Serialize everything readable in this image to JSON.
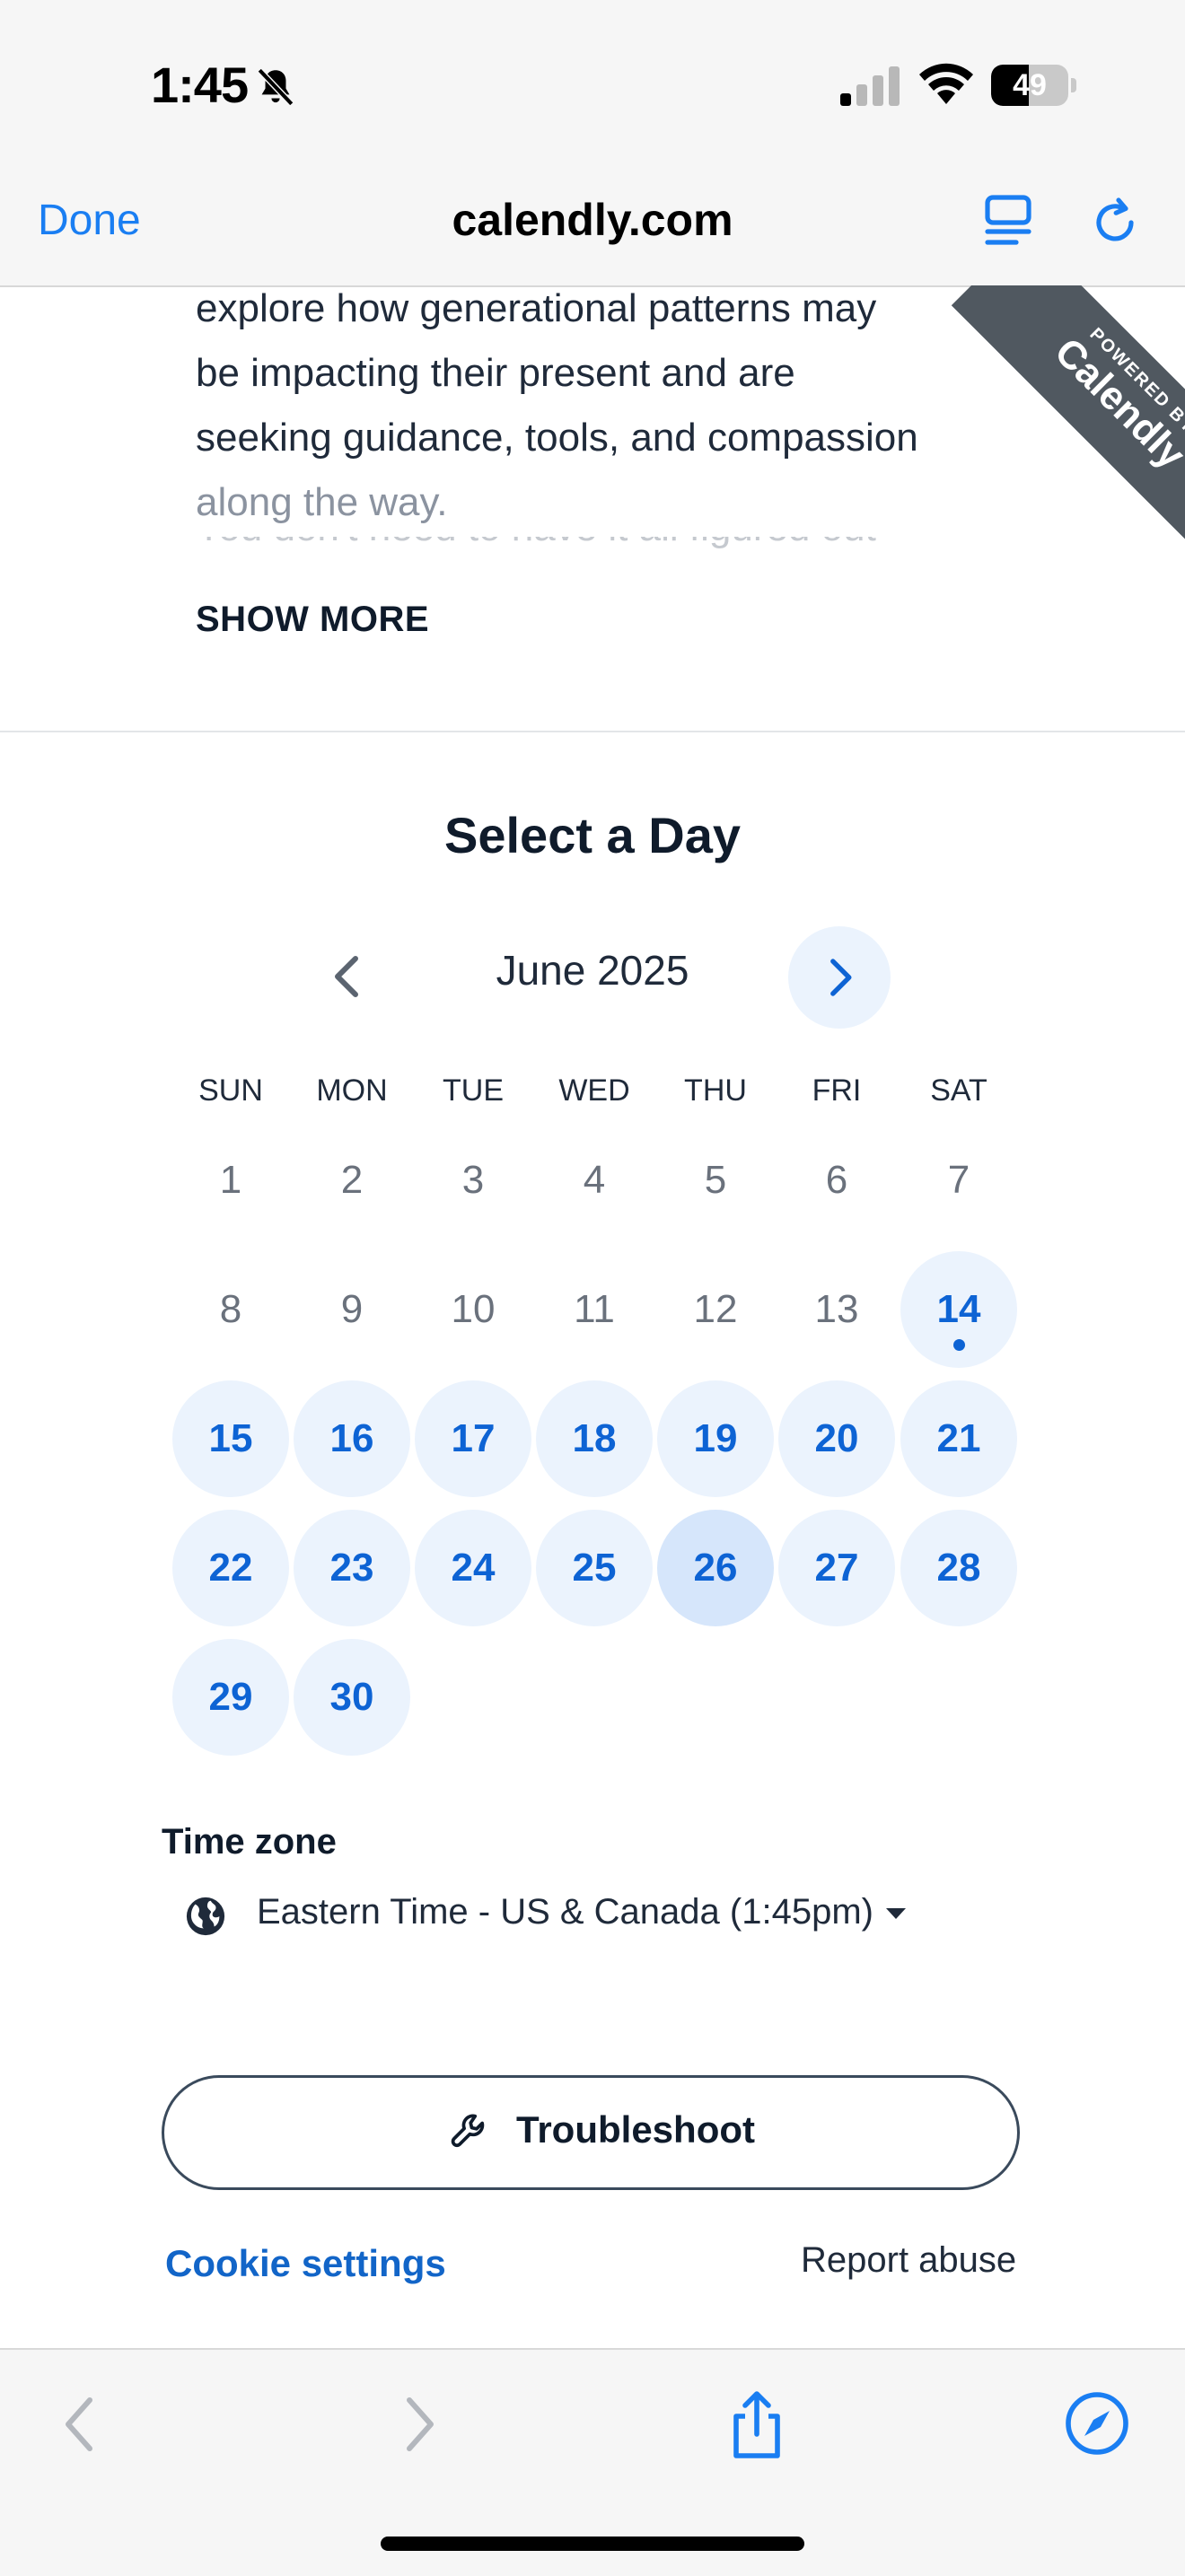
{
  "status_bar": {
    "time": "1:45",
    "battery_level": "49",
    "icons": [
      "bell-slash-icon",
      "cellular-signal-icon",
      "wifi-icon",
      "battery-icon"
    ]
  },
  "browser": {
    "done_label": "Done",
    "domain": "calendly.com",
    "icons": [
      "reader-icon",
      "reload-icon"
    ]
  },
  "description": {
    "lines": [
      "explore how generational patterns may",
      "be impacting their present and are",
      "seeking guidance, tools, and compassion",
      "along the way."
    ],
    "cut_line": "You don't need to have it all figured out",
    "show_more": "SHOW MORE"
  },
  "ribbon": {
    "small": "POWERED BY",
    "big": "Calendly"
  },
  "calendar": {
    "title": "Select a Day",
    "month": "June 2025",
    "weekdays": [
      "SUN",
      "MON",
      "TUE",
      "WED",
      "THU",
      "FRI",
      "SAT"
    ],
    "first_weekday_index": 0,
    "days_in_month": 30,
    "available_days": [
      14,
      15,
      16,
      17,
      18,
      19,
      20,
      21,
      22,
      23,
      24,
      25,
      26,
      27,
      28,
      29,
      30
    ],
    "selected_day": 26,
    "today_dot_day": 14,
    "accent_color": "#0d63d4"
  },
  "timezone": {
    "label": "Time zone",
    "value": "Eastern Time - US & Canada (1:45pm)",
    "icon": "globe-icon"
  },
  "footer": {
    "troubleshoot_label": "Troubleshoot",
    "cookie_label": "Cookie settings",
    "report_label": "Report abuse"
  },
  "toolbar": {
    "icons": [
      "back-icon",
      "forward-icon",
      "share-icon",
      "compass-icon"
    ]
  }
}
